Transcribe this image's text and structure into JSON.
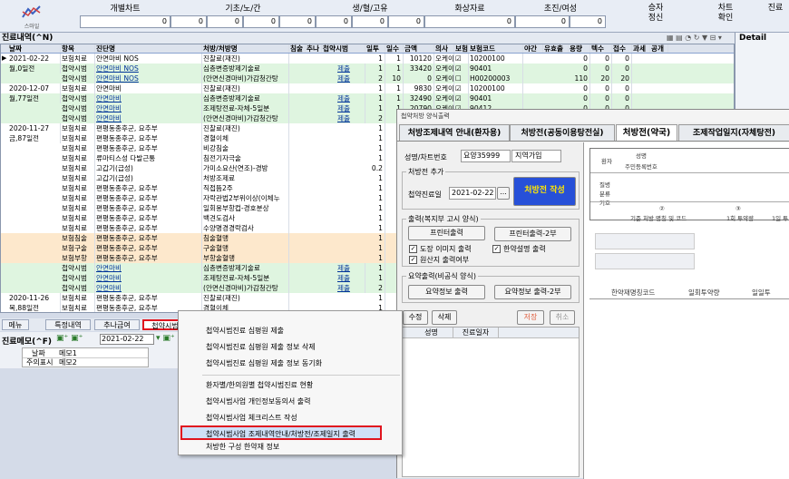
{
  "toolbar": {
    "logo_text": "스마일",
    "columns": [
      {
        "label": "개별차트",
        "value": "0"
      },
      {
        "label": "기초/노/간",
        "value": "0"
      },
      {
        "label": "생/혈/고유",
        "value": "0"
      },
      {
        "label": "화상자료",
        "value": "0"
      },
      {
        "label": "초진/여성",
        "value": "0"
      }
    ],
    "extra_values": [
      "0",
      "0",
      "0",
      "0",
      "0",
      "0",
      "0"
    ],
    "right_buttons": [
      {
        "line1": "승자",
        "line2": "정신"
      },
      {
        "line1": "차트",
        "line2": "확인"
      },
      {
        "line1": "",
        "line2": "진료"
      }
    ]
  },
  "history": {
    "title": "진료내역(^N)",
    "detail_label": "Detail",
    "columns": [
      "날짜",
      "항목",
      "진단명",
      "처방/처방명",
      "침술",
      "추나",
      "첩약시범",
      "일투",
      "일수",
      "금액",
      "의사",
      "보험",
      "보험코드",
      "야간",
      "유효출",
      "용량",
      "텍수",
      "접수",
      "과세",
      "공개"
    ],
    "rows": [
      {
        "date": "2021-02-22",
        "type": "보험치료",
        "diag": "안면마비 NOS",
        "rx": "진찰료(재진)",
        "pilot": "",
        "day": "1",
        "days": "1",
        "amt": "10120",
        "doc": "오케이",
        "ins": "☑",
        "code": "10200100",
        "dose": "0",
        "t1": "0",
        "t2": "0",
        "cls": "ins"
      },
      {
        "date": "월,0일전",
        "type": "첩약시범",
        "diag": "안면마비 NOS",
        "rx": "심층변증방제기술료",
        "pilot": "제출",
        "day": "1",
        "days": "1",
        "amt": "33420",
        "doc": "오케이",
        "ins": "☑",
        "code": "90401",
        "dose": "0",
        "t1": "0",
        "t2": "0",
        "cls": "pilot"
      },
      {
        "date": "",
        "type": "첩약시범",
        "diag": "안면마비 NOS",
        "rx": "(안면신경마비)가감청간탕",
        "pilot": "제출",
        "day": "2",
        "days": "10",
        "amt": "0",
        "doc": "오케이",
        "ins": "☐",
        "code": "H00200003",
        "dose": "110",
        "t1": "20",
        "t2": "20",
        "cls": "pilot"
      },
      {
        "date": "2020-12-07",
        "type": "보험치료",
        "diag": "안면마비",
        "rx": "진찰료(재진)",
        "pilot": "",
        "day": "1",
        "days": "1",
        "amt": "9830",
        "doc": "오케이",
        "ins": "☑",
        "code": "10200100",
        "dose": "0",
        "t1": "0",
        "t2": "0",
        "cls": "ins"
      },
      {
        "date": "월,77일전",
        "type": "첩약시범",
        "diag": "안면마비",
        "rx": "심층변증방제기술료",
        "pilot": "제출",
        "day": "1",
        "days": "1",
        "amt": "32490",
        "doc": "오케이",
        "ins": "☑",
        "code": "90401",
        "dose": "0",
        "t1": "0",
        "t2": "0",
        "cls": "pilot"
      },
      {
        "date": "",
        "type": "첩약시범",
        "diag": "안면마비",
        "rx": "조제탕전료-자체-5일분",
        "pilot": "제출",
        "day": "1",
        "days": "1",
        "amt": "20790",
        "doc": "오케이",
        "ins": "☑",
        "code": "90412",
        "dose": "0",
        "t1": "0",
        "t2": "0",
        "cls": "pilot"
      },
      {
        "date": "",
        "type": "첩약시범",
        "diag": "안면마비",
        "rx": "(안면신경마비)가감청간탕",
        "pilot": "제출",
        "day": "2",
        "days": "",
        "amt": "",
        "doc": "",
        "ins": "",
        "code": "",
        "dose": "",
        "t1": "",
        "t2": "",
        "cls": "pilot"
      },
      {
        "date": "2020-11-27",
        "type": "보험치료",
        "diag": "편평동종후군, 요추부",
        "rx": "진찰료(재진)",
        "pilot": "",
        "day": "1",
        "days": "",
        "amt": "",
        "doc": "",
        "ins": "",
        "code": "",
        "dose": "",
        "t1": "",
        "t2": "",
        "cls": "ins"
      },
      {
        "date": "금,87일전",
        "type": "보험치료",
        "diag": "편평동종후군, 요추부",
        "rx": "경혈이체",
        "pilot": "",
        "day": "1",
        "days": "",
        "amt": "",
        "doc": "",
        "ins": "",
        "code": "",
        "dose": "",
        "t1": "",
        "t2": "",
        "cls": "ins"
      },
      {
        "date": "",
        "type": "보험치료",
        "diag": "편평동종후군, 요추부",
        "rx": "비강침술",
        "pilot": "",
        "day": "1",
        "days": "",
        "amt": "",
        "doc": "",
        "ins": "",
        "code": "",
        "dose": "",
        "t1": "",
        "t2": "",
        "cls": "ins"
      },
      {
        "date": "",
        "type": "보험치료",
        "diag": "류마티스성 다발근통",
        "rx": "침전기자극술",
        "pilot": "",
        "day": "1",
        "days": "",
        "amt": "",
        "doc": "",
        "ins": "",
        "code": "",
        "dose": "",
        "t1": "",
        "t2": "",
        "cls": "ins"
      },
      {
        "date": "",
        "type": "보험치료",
        "diag": "고갑기(급성)",
        "rx": "가미소요산(연조)-경방",
        "pilot": "",
        "day": "0.2",
        "days": "",
        "amt": "",
        "doc": "",
        "ins": "",
        "code": "",
        "dose": "",
        "t1": "",
        "t2": "",
        "cls": "ins"
      },
      {
        "date": "",
        "type": "보험치료",
        "diag": "고갑기(급성)",
        "rx": "처방조제료",
        "pilot": "",
        "day": "1",
        "days": "",
        "amt": "",
        "doc": "",
        "ins": "",
        "code": "",
        "dose": "",
        "t1": "",
        "t2": "",
        "cls": "ins"
      },
      {
        "date": "",
        "type": "보험치료",
        "diag": "편평동종후군, 요추부",
        "rx": "직접뜸2주",
        "pilot": "",
        "day": "1",
        "days": "",
        "amt": "",
        "doc": "",
        "ins": "",
        "code": "",
        "dose": "",
        "t1": "",
        "t2": "",
        "cls": "ins"
      },
      {
        "date": "",
        "type": "보험치료",
        "diag": "편평동종후군, 요추부",
        "rx": "자락관법2부위이상(이체누",
        "pilot": "",
        "day": "1",
        "days": "",
        "amt": "",
        "doc": "",
        "ins": "",
        "code": "",
        "dose": "",
        "t1": "",
        "t2": "",
        "cls": "ins"
      },
      {
        "date": "",
        "type": "보험치료",
        "diag": "편평동종후군, 요추부",
        "rx": "일회용부항컵-경호분상",
        "pilot": "",
        "day": "1",
        "days": "",
        "amt": "",
        "doc": "",
        "ins": "",
        "code": "",
        "dose": "",
        "t1": "",
        "t2": "",
        "cls": "ins"
      },
      {
        "date": "",
        "type": "보험치료",
        "diag": "편평동종후군, 요추부",
        "rx": "백견도검사",
        "pilot": "",
        "day": "1",
        "days": "",
        "amt": "",
        "doc": "",
        "ins": "",
        "code": "",
        "dose": "",
        "t1": "",
        "t2": "",
        "cls": "ins"
      },
      {
        "date": "",
        "type": "보험치료",
        "diag": "편평동종후군, 요추부",
        "rx": "수양명경경락검사",
        "pilot": "",
        "day": "1",
        "days": "",
        "amt": "",
        "doc": "",
        "ins": "",
        "code": "",
        "dose": "",
        "t1": "",
        "t2": "",
        "cls": "ins"
      },
      {
        "date": "",
        "type": "보험침술",
        "diag": "편평동종후군, 요추부",
        "rx": "침술혈맹",
        "pilot": "",
        "day": "1",
        "days": "",
        "amt": "",
        "doc": "",
        "ins": "",
        "code": "",
        "dose": "",
        "t1": "",
        "t2": "",
        "cls": "acu"
      },
      {
        "date": "",
        "type": "보험구술",
        "diag": "편평동종후군, 요추부",
        "rx": "구술혈맹",
        "pilot": "",
        "day": "1",
        "days": "",
        "amt": "",
        "doc": "",
        "ins": "",
        "code": "",
        "dose": "",
        "t1": "",
        "t2": "",
        "cls": "acu"
      },
      {
        "date": "",
        "type": "보험부항",
        "diag": "편평동종후군, 요추부",
        "rx": "부항술혈맹",
        "pilot": "",
        "day": "1",
        "days": "",
        "amt": "",
        "doc": "",
        "ins": "",
        "code": "",
        "dose": "",
        "t1": "",
        "t2": "",
        "cls": "acu"
      },
      {
        "date": "",
        "type": "첩약시범",
        "diag": "안면마비",
        "rx": "심층변증방제기술료",
        "pilot": "제출",
        "day": "1",
        "days": "",
        "amt": "",
        "doc": "",
        "ins": "",
        "code": "",
        "dose": "",
        "t1": "",
        "t2": "",
        "cls": "pilot"
      },
      {
        "date": "",
        "type": "첩약시범",
        "diag": "안면마비",
        "rx": "조제탕전료-자체-5일분",
        "pilot": "제출",
        "day": "1",
        "days": "",
        "amt": "",
        "doc": "",
        "ins": "",
        "code": "",
        "dose": "",
        "t1": "",
        "t2": "",
        "cls": "pilot"
      },
      {
        "date": "",
        "type": "첩약시범",
        "diag": "안면마비",
        "rx": "(안면신경마비)가감청간탕",
        "pilot": "제출",
        "day": "2",
        "days": "",
        "amt": "",
        "doc": "",
        "ins": "",
        "code": "",
        "dose": "",
        "t1": "",
        "t2": "",
        "cls": "pilot"
      },
      {
        "date": "2020-11-26",
        "type": "보험치료",
        "diag": "편평동종후군, 요추부",
        "rx": "진찰료(재진)",
        "pilot": "",
        "day": "1",
        "days": "",
        "amt": "",
        "doc": "",
        "ins": "",
        "code": "",
        "dose": "",
        "t1": "",
        "t2": "",
        "cls": "ins"
      },
      {
        "date": "목,88일전",
        "type": "보험치료",
        "diag": "편평동종후군, 요추부",
        "rx": "경혈이체",
        "pilot": "",
        "day": "1",
        "days": "",
        "amt": "",
        "doc": "",
        "ins": "",
        "code": "",
        "dose": "",
        "t1": "",
        "t2": "",
        "cls": "ins"
      }
    ]
  },
  "bottom_tabs": [
    "메뉴",
    "특정내역",
    "추나금여",
    "첩약시범"
  ],
  "memo": {
    "title": "진료메모(^F)",
    "date": "2021-02-22",
    "col_date": "날짜",
    "col_memo": "메모1",
    "row_label": "주의표시",
    "row_value": "메모2"
  },
  "context_menu": {
    "items": [
      "첩약시범진료 심평원 제출",
      "첩약시범진료 심평원 제출 정보 삭제",
      "첩약시범진료 심평원 제출 정보 동기화",
      "환자별/한의원별 첩약시범진료 현황",
      "첩약시범사업 개인정보동의서 출력",
      "첩약시범사업 체크리스트 작성",
      "첩약시범사업 조제내역안내/처방전/조제일지 출력",
      "처방한 구성 한약재 정보"
    ]
  },
  "dialog": {
    "title": "첩약처방 양식출력",
    "tabs": [
      "처방조제내역 안내(환자용)",
      "처방전(공동이용탕전실)",
      "처방전(약국)",
      "조제작업일지(자체탕전)"
    ],
    "chart_label": "성명/차트번호",
    "chart_value": "요양35999",
    "chart_extra": "지역가입",
    "add_section": "처방전 추가",
    "date_label": "첩약진료일",
    "date_value": "2021-02-22",
    "ellipsis": "...",
    "create_btn": "처방전 작성",
    "print_section": "출력(복지부 고시 양식)",
    "print_btn": "프린터출력",
    "print_btn2": "프린터출력-2부",
    "opt1": "도장 이미지 출력",
    "opt2": "한약설명 출력",
    "opt3": "원산지 출력여부",
    "summary_section": "요약출력(비공식 양식)",
    "sum_btn": "요약정보 출력",
    "sum_btn2": "요약정보 출력-2부",
    "edit_btn": "수정",
    "delete_btn": "삭제",
    "save_btn": "저장",
    "cancel_btn": "취소",
    "list_col1": "성명",
    "list_col2": "진료일자",
    "preview": {
      "patient": "환자",
      "name": "성명",
      "rrn": "주민등록번호",
      "disease": "질병분류기호",
      "col2_num": "②",
      "col2_label": "기준 처방 명칭 및 코드",
      "col3_num": "③",
      "col3_label": "1회 투약량",
      "col4_label": "1일 투",
      "herb_code": "한약재명칭코드",
      "daily": "일회투약량",
      "daily2": "일일투"
    }
  }
}
